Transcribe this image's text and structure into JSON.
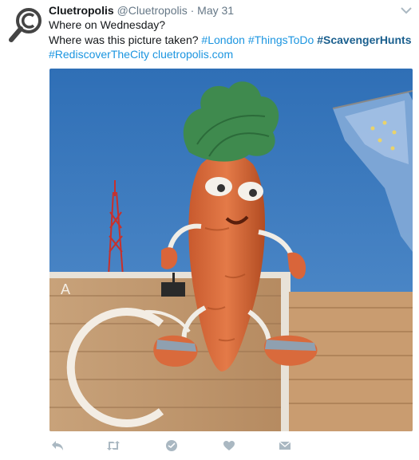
{
  "tweet": {
    "display_name": "Cluetropolis",
    "handle": "@Cluetropolis",
    "separator": "·",
    "date": "May 31",
    "line1": "Where on Wednesday?",
    "line2_text": "Where was this picture taken?",
    "hashtag_london": "#London",
    "hashtag_things": "#ThingsToDo",
    "hashtag_scavenger": "#ScavengerHunts",
    "hashtag_rediscover": "#RediscoverTheCity",
    "url": "cluetropolis.com"
  },
  "photo": {
    "sign_letter": "A"
  },
  "icons": {
    "avatar": "magnifying-glass-copyright-icon",
    "menu": "chevron-down-icon",
    "reply": "reply-icon",
    "retweet": "retweet-icon",
    "direct": "direct-message-icon",
    "like": "heart-icon",
    "mail": "envelope-icon"
  },
  "colors": {
    "link": "#1b95e0",
    "strong_link": "#1a5f8e",
    "meta": "#657786",
    "action_icon": "#aab8c2",
    "sky": "#3d78b8"
  }
}
